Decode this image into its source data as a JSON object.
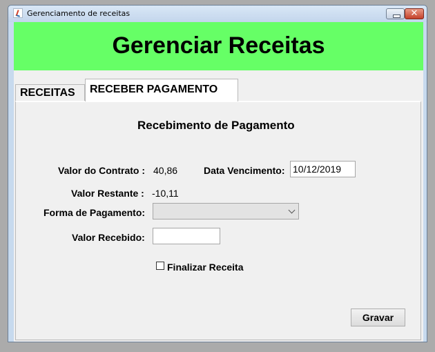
{
  "window": {
    "title": "Gerenciamento de receitas",
    "icon": "java-app-icon",
    "controls": {
      "minimize": "minimize-icon",
      "close": "✕"
    }
  },
  "banner": {
    "title": "Gerenciar Receitas",
    "bg_color": "#66ff66"
  },
  "tabs": [
    {
      "label": "RECEITAS",
      "selected": false
    },
    {
      "label": "RECEBER PAGAMENTO",
      "selected": true
    }
  ],
  "form": {
    "section_title": "Recebimento de Pagamento",
    "valor_contrato_label": "Valor do Contrato :",
    "valor_contrato_value": "40,86",
    "data_vencimento_label": "Data Vencimento:",
    "data_vencimento_value": "10/12/2019",
    "valor_restante_label": "Valor Restante :",
    "valor_restante_value": "-10,11",
    "forma_pagamento_label": "Forma de Pagamento:",
    "forma_pagamento_value": "",
    "valor_recebido_label": "Valor Recebido:",
    "valor_recebido_value": "",
    "finalizar_label": "Finalizar Receita",
    "finalizar_checked": false,
    "gravar_label": "Gravar"
  }
}
